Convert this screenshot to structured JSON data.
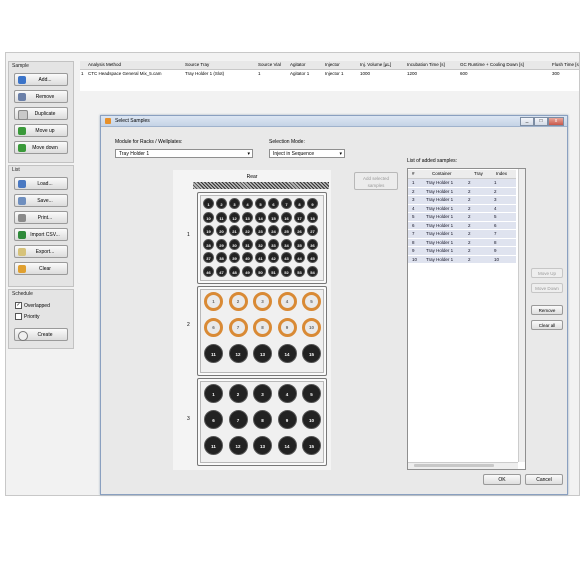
{
  "left_panel": {
    "sample_group": {
      "title": "Sample",
      "buttons": [
        "Add...",
        "Remove",
        "Duplicate",
        "Move up",
        "Move down"
      ]
    },
    "list_group": {
      "title": "List",
      "buttons": [
        "Load...",
        "Save...",
        "Print...",
        "Import CSV...",
        "Export...",
        "Clear"
      ]
    },
    "schedule_group": {
      "title": "Schedule",
      "checkboxes": [
        {
          "label": "Overlapped",
          "checked": true
        },
        {
          "label": "Priority",
          "checked": false
        }
      ],
      "create_label": "Create"
    }
  },
  "grid": {
    "columns": [
      "",
      "Analysis Method",
      "Source Tray",
      "Source Vial",
      "Agitator",
      "Injector",
      "Inj. Volume [µL]",
      "Incubation Time [s]",
      "GC Runtime + Cooling Down [s]",
      "Flush Time [s]"
    ],
    "rows": [
      [
        "1",
        "CTC Headspace General Mix_5.cam",
        "Tray Holder 1 (Slot)",
        "1",
        "Agitator 1",
        "Injector 1",
        "1000",
        "1200",
        "600",
        "300"
      ]
    ]
  },
  "dialog": {
    "title": "Select Samples",
    "window_buttons": [
      "_",
      "□",
      "x"
    ],
    "module_label": "Module for Racks / Wellplates:",
    "module_value": "Tray Holder 1",
    "mode_label": "Selection Mode:",
    "mode_value": "Inject in Sequence",
    "rear_label": "Rear",
    "tray_numbers": [
      "1",
      "2",
      "3"
    ],
    "add_selected_label": "Add selected samples",
    "list_label": "List of added samples:",
    "list_columns": [
      "#",
      "Container",
      "Tray",
      "Index"
    ],
    "list_rows": [
      [
        "1",
        "Tray Holder 1",
        "2",
        "1"
      ],
      [
        "2",
        "Tray Holder 1",
        "2",
        "2"
      ],
      [
        "3",
        "Tray Holder 1",
        "2",
        "3"
      ],
      [
        "4",
        "Tray Holder 1",
        "2",
        "4"
      ],
      [
        "5",
        "Tray Holder 1",
        "2",
        "5"
      ],
      [
        "6",
        "Tray Holder 1",
        "2",
        "6"
      ],
      [
        "7",
        "Tray Holder 1",
        "2",
        "7"
      ],
      [
        "8",
        "Tray Holder 1",
        "2",
        "8"
      ],
      [
        "9",
        "Tray Holder 1",
        "2",
        "9"
      ],
      [
        "10",
        "Tray Holder 1",
        "2",
        "10"
      ]
    ],
    "side_buttons": [
      {
        "label": "Move Up",
        "enabled": false
      },
      {
        "label": "Move Down",
        "enabled": false
      },
      {
        "label": "Remove",
        "enabled": true
      },
      {
        "label": "Clear all",
        "enabled": true
      }
    ],
    "ok_label": "OK",
    "cancel_label": "Cancel",
    "selected_color": "#d98a35",
    "vial_color": "#222222"
  }
}
